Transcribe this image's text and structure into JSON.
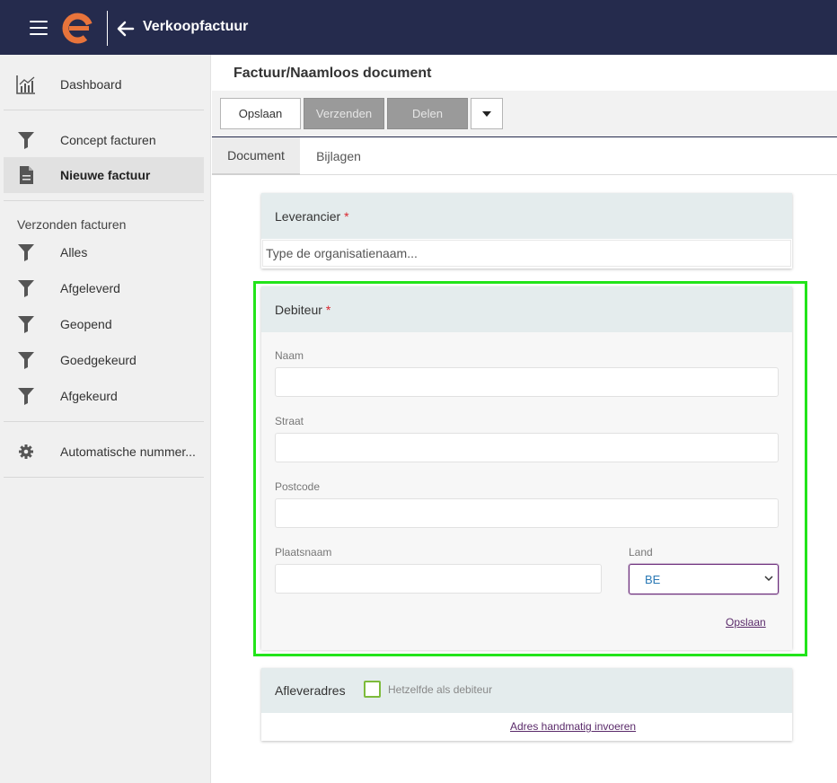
{
  "header": {
    "title": "Verkoopfactuur",
    "logo_color": "#e8743b",
    "bg_color": "#252b4d"
  },
  "sidebar": {
    "items_top": [
      {
        "label": "Dashboard",
        "icon": "bar-chart-icon"
      }
    ],
    "items_concept": [
      {
        "label": "Concept facturen",
        "icon": "filter-icon"
      },
      {
        "label": "Nieuwe factuur",
        "icon": "document-icon",
        "active": true
      }
    ],
    "sent_heading": "Verzonden facturen",
    "items_sent": [
      {
        "label": "Alles",
        "icon": "filter-icon"
      },
      {
        "label": "Afgeleverd",
        "icon": "filter-icon"
      },
      {
        "label": "Geopend",
        "icon": "filter-icon"
      },
      {
        "label": "Goedgekeurd",
        "icon": "filter-icon"
      },
      {
        "label": "Afgekeurd",
        "icon": "filter-icon"
      }
    ],
    "items_bottom": [
      {
        "label": "Automatische nummer...",
        "icon": "gear-icon"
      }
    ]
  },
  "main": {
    "title": "Factuur/Naamloos document",
    "toolbar": {
      "save_label": "Opslaan",
      "send_label": "Verzenden",
      "share_label": "Delen"
    },
    "tabs": [
      {
        "label": "Document",
        "active": true
      },
      {
        "label": "Bijlagen",
        "active": false
      }
    ],
    "supplier": {
      "title": "Leverancier",
      "required_mark": "*",
      "placeholder": "Type de organisatienaam..."
    },
    "debtor": {
      "title": "Debiteur",
      "required_mark": "*",
      "name_label": "Naam",
      "street_label": "Straat",
      "postcode_label": "Postcode",
      "city_label": "Plaatsnaam",
      "country_label": "Land",
      "country_value": "BE",
      "save_link": "Opslaan"
    },
    "delivery": {
      "title": "Afleveradres",
      "same_as_debtor_label": "Hetzelfde als debiteur",
      "same_as_debtor_checked": false,
      "manual_link": "Adres handmatig invoeren"
    }
  }
}
